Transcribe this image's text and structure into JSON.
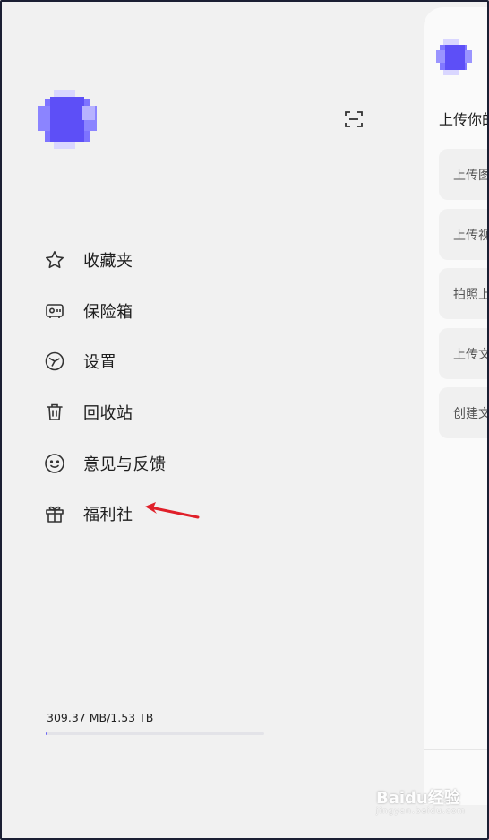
{
  "drawer": {
    "menu": [
      {
        "label": "收藏夹",
        "icon": "star-icon"
      },
      {
        "label": "保险箱",
        "icon": "safe-icon"
      },
      {
        "label": "设置",
        "icon": "settings-icon"
      },
      {
        "label": "回收站",
        "icon": "trash-icon"
      },
      {
        "label": "意见与反馈",
        "icon": "smiley-icon"
      },
      {
        "label": "福利社",
        "icon": "gift-icon"
      }
    ],
    "storage": {
      "text": "309.37 MB/1.53 TB",
      "used_fraction": 0.0002
    }
  },
  "panel": {
    "title": "上传你的",
    "cards": [
      "上传图片",
      "上传视频",
      "拍照上传",
      "上传文件",
      "创建文件夹"
    ]
  },
  "watermark": {
    "text": "Baidu经验",
    "sub": "jingyan.baidu.com"
  },
  "colors": {
    "accent": "#6b64f5",
    "arrow": "#e0202a",
    "background": "#f1f1f1"
  }
}
